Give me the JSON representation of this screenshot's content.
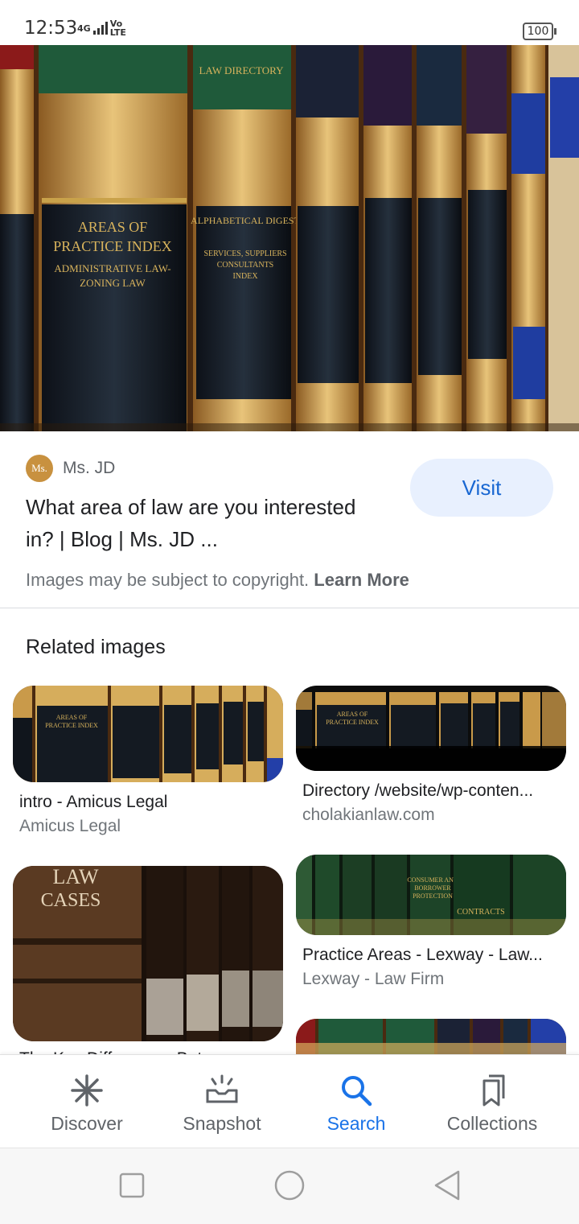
{
  "status_bar": {
    "time": "12:53",
    "network": "4G",
    "volte": "Vo LTE",
    "battery": "100"
  },
  "hero": {
    "book_spines": [
      "AREAS OF PRACTICE INDEX",
      "ADMINISTRATIVE LAW-ZONING LAW",
      "ALPHABETICAL DIGEST",
      "SERVICES, SUPPLIERS, CONSULTANTS INDEX",
      "LAW DIRECTORY"
    ]
  },
  "result": {
    "source_initials": "Ms.",
    "source_name": "Ms. JD",
    "title": "What area of law are you interested in? | Blog | Ms. JD ...",
    "visit_label": "Visit",
    "copyright_text": "Images may be subject to copyright.",
    "learn_more": "Learn More"
  },
  "related": {
    "heading": "Related images",
    "items": [
      {
        "title": "intro - Amicus Legal",
        "source": "Amicus Legal"
      },
      {
        "title": "Directory /website/wp-conten...",
        "source": "cholakianlaw.com"
      },
      {
        "title": "The Key Differences Between...",
        "source": ""
      },
      {
        "title": "Practice Areas - Lexway - Law...",
        "source": "Lexway - Law Firm"
      }
    ],
    "image_texts": {
      "law_cases": "LAW CASES",
      "contracts": "CONTRACTS",
      "consumer": "CONSUMER AND BORROWER PROTECTION"
    }
  },
  "bottom_nav": [
    {
      "label": "Discover",
      "icon": "asterisk-icon"
    },
    {
      "label": "Snapshot",
      "icon": "snapshot-icon"
    },
    {
      "label": "Search",
      "icon": "search-icon"
    },
    {
      "label": "Collections",
      "icon": "collections-icon"
    }
  ],
  "colors": {
    "accent": "#1a73e8",
    "visit_bg": "#e8f0fe"
  }
}
